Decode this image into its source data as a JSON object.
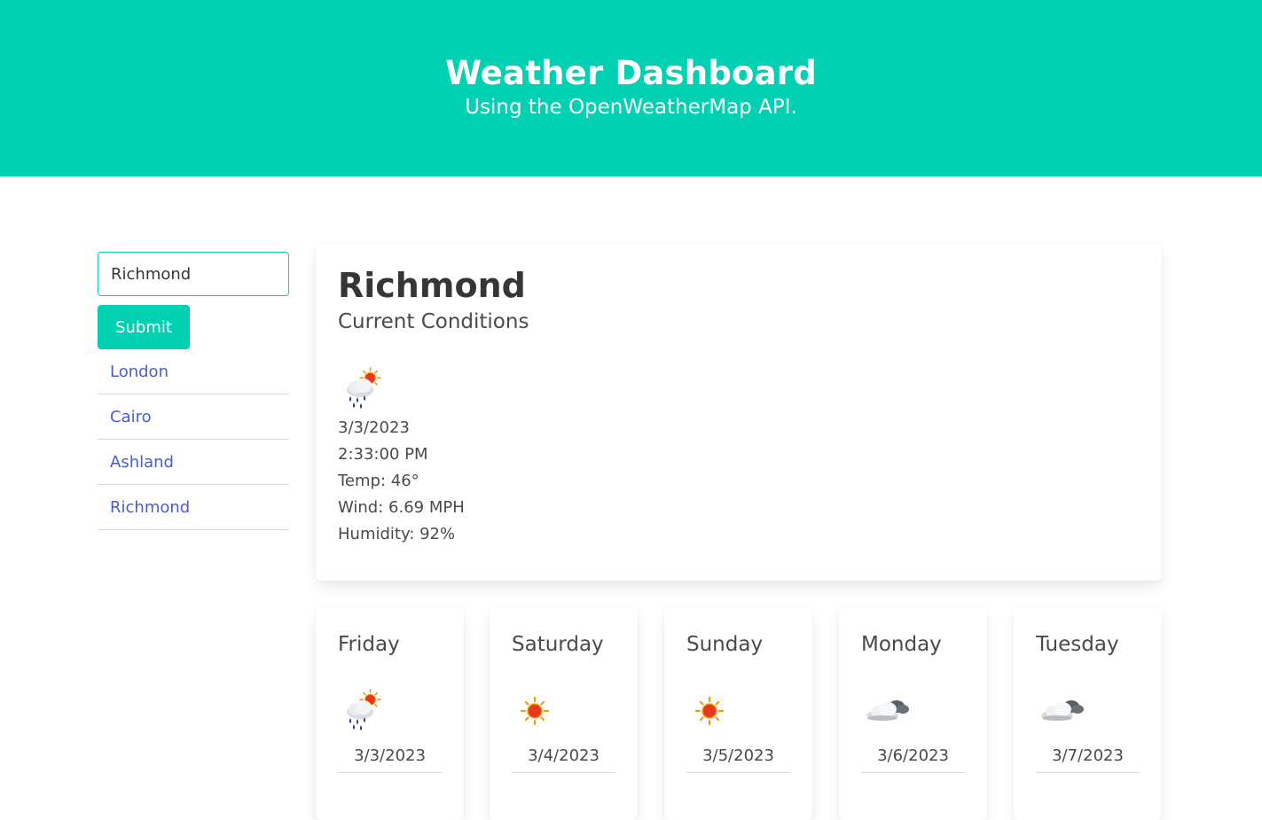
{
  "header": {
    "title": "Weather Dashboard",
    "subtitle": "Using the OpenWeatherMap API."
  },
  "search": {
    "value": "Richmond",
    "submit_label": "Submit"
  },
  "history": [
    "London",
    "Cairo",
    "Ashland",
    "Richmond"
  ],
  "current": {
    "city": "Richmond",
    "subtitle": "Current Conditions",
    "icon": "rain-sun-icon",
    "date": "3/3/2023",
    "time": "2:33:00 PM",
    "temp": "Temp: 46°",
    "wind": "Wind: 6.69 MPH",
    "humidity": "Humidity: 92%"
  },
  "forecast": [
    {
      "day": "Friday",
      "icon": "rain-sun-icon",
      "date": "3/3/2023"
    },
    {
      "day": "Saturday",
      "icon": "sun-icon",
      "date": "3/4/2023"
    },
    {
      "day": "Sunday",
      "icon": "sun-icon",
      "date": "3/5/2023"
    },
    {
      "day": "Monday",
      "icon": "cloud-icon",
      "date": "3/6/2023"
    },
    {
      "day": "Tuesday",
      "icon": "cloud-icon",
      "date": "3/7/2023"
    }
  ],
  "colors": {
    "primary": "#00d1b2",
    "link": "#485fc7",
    "text": "#4a4a4a",
    "heading": "#363636"
  }
}
